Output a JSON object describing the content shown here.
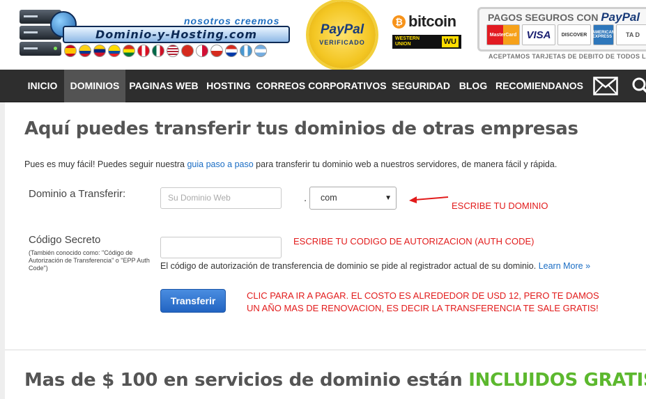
{
  "header": {
    "slogan": "nosotros creemos",
    "logo_text": "Dominio-y-Hosting.com",
    "paypal_seal": {
      "brand": "PayPal",
      "label": "VERIFICADO"
    },
    "bitcoin_text": "bitcoin",
    "western_union": {
      "line1": "WESTERN",
      "line2": "UNION",
      "mark": "WU"
    },
    "pagos_title": "PAGOS SEGUROS CON",
    "pagos_brand": "PayPal",
    "cards": [
      "MasterCard",
      "VISA",
      "DISCOVER",
      "AMERICAN EXPRESS",
      "TA D"
    ],
    "aceptamos": "ACEPTAMOS TARJETAS DE DEBITO DE TODOS L"
  },
  "nav": {
    "items": [
      "INICIO",
      "DOMINIOS",
      "PAGINAS WEB",
      "HOSTING",
      "CORREOS CORPORATIVOS",
      "SEGURIDAD",
      "BLOG",
      "RECOMIENDANOS"
    ],
    "active": "DOMINIOS"
  },
  "main": {
    "title": "Aquí puedes transferir tus dominios de otras empresas",
    "intro_before": "Pues es muy fácil! Puedes seguir nuestra ",
    "intro_link": "guia paso a paso",
    "intro_after": " para transferir tu dominio web a nuestros servidores, de manera fácil y rápida.",
    "domain_label": "Dominio a Transferir:",
    "domain_placeholder": "Su Dominio Web",
    "dot": ".",
    "tld_selected": "com",
    "annotation_domain": "ESCRIBE TU DOMINIO",
    "code_label": "Código Secreto",
    "code_note": "(También conocido como: \"Código de Autorización de Transferencia\" o \"EPP Auth Code\")",
    "annotation_code": "ESCRIBE TU CODIGO DE AUTORIZACION (AUTH CODE)",
    "auth_help": "El código de autorización de transferencia de dominio se pide al registrador actual de su dominio. ",
    "learn_more": "Learn More »",
    "button": "Transferir",
    "annotation_pay_1": "CLIC PARA IR A PAGAR. EL COSTO ES ALREDEDOR DE USD 12, PERO TE DAMOS",
    "annotation_pay_2": "UN AÑO MAS DE RENOVACION, ES DECIR LA TRANSFERENCIA TE SALE GRATIS!"
  },
  "bottom": {
    "title_before": "Mas de $ 100 en servicios de dominio están ",
    "title_highlight": "INCLUIDOS GRATIS"
  },
  "colors": {
    "nav_bg": "#2e2e2e",
    "nav_active": "#535353",
    "annotation_red": "#e21b1b",
    "link_blue": "#1a6dc4",
    "highlight_green": "#5cb82e"
  }
}
